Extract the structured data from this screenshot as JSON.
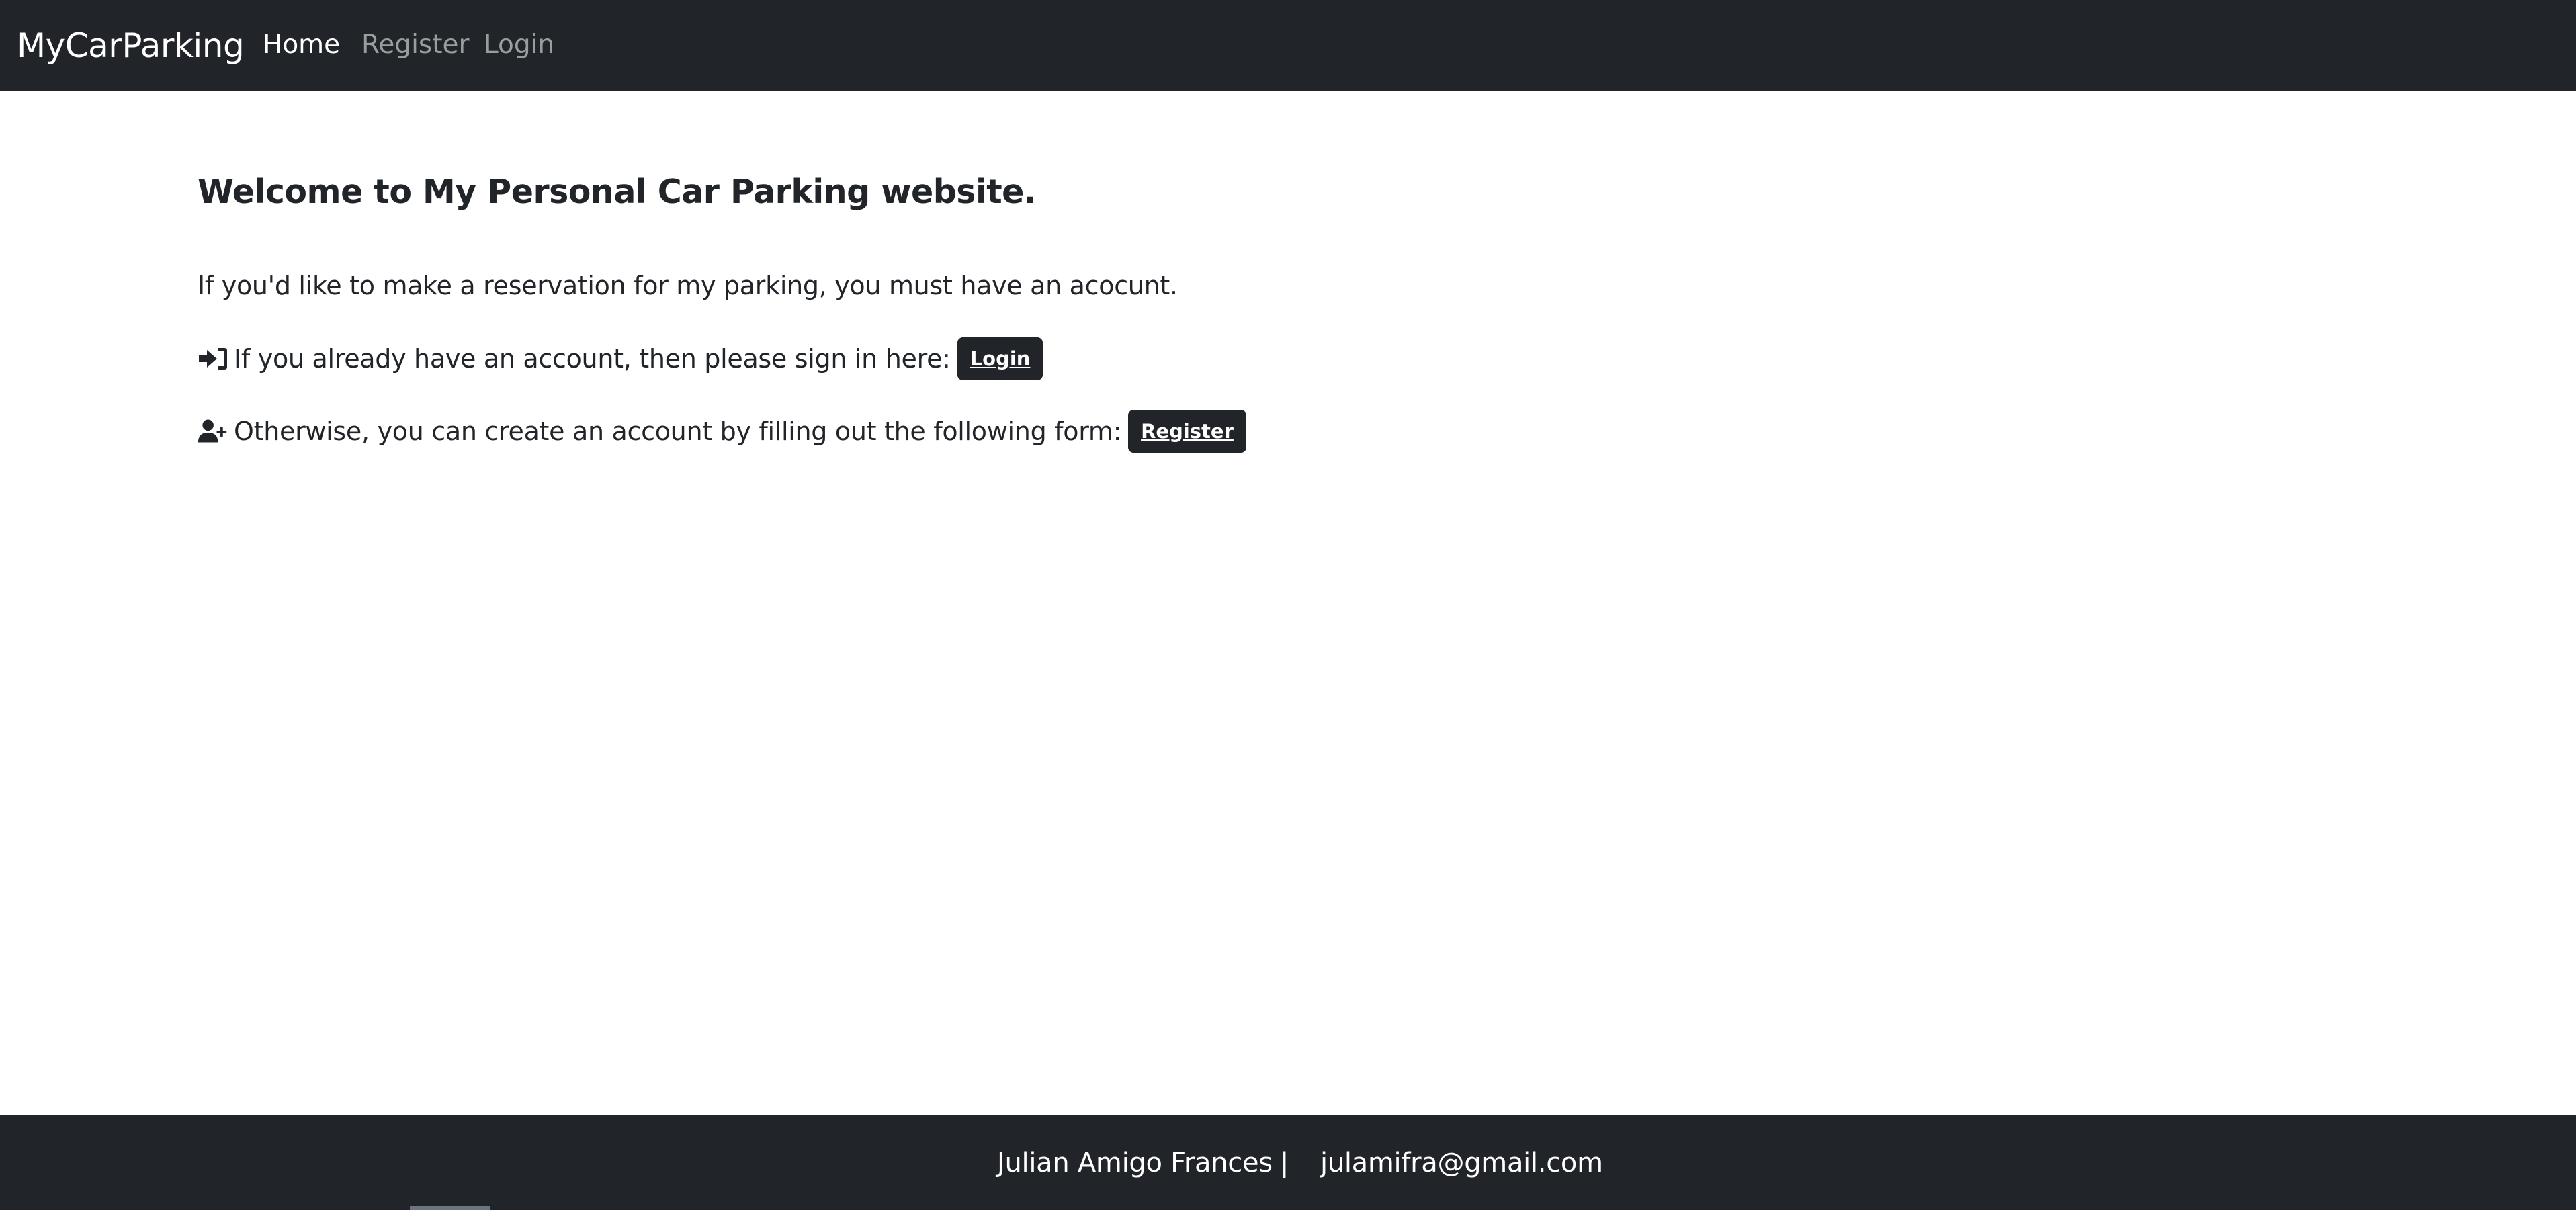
{
  "navbar": {
    "brand": "MyCarParking",
    "links": [
      {
        "label": "Home",
        "active": true
      },
      {
        "label": "Register",
        "active": false
      },
      {
        "label": "Login",
        "active": false
      }
    ]
  },
  "main": {
    "heading": "Welcome to My Personal Car Parking website.",
    "intro": "If you'd like to make a reservation for my parking, you must have an acocunt.",
    "login_row": {
      "icon": "sign-in-icon",
      "text": "If you already have an account, then please sign in here:",
      "button_label": "Login"
    },
    "register_row": {
      "icon": "user-plus-icon",
      "text": "Otherwise, you can create an account by filling out the following form:",
      "button_label": "Register"
    }
  },
  "footer": {
    "name": "Julian Amigo Frances",
    "separator": "|",
    "email": "julamifra@gmail.com"
  },
  "colors": {
    "dark": "#212529",
    "text": "#212529",
    "nav_muted": "rgba(255,255,255,0.55)",
    "white": "#ffffff"
  }
}
